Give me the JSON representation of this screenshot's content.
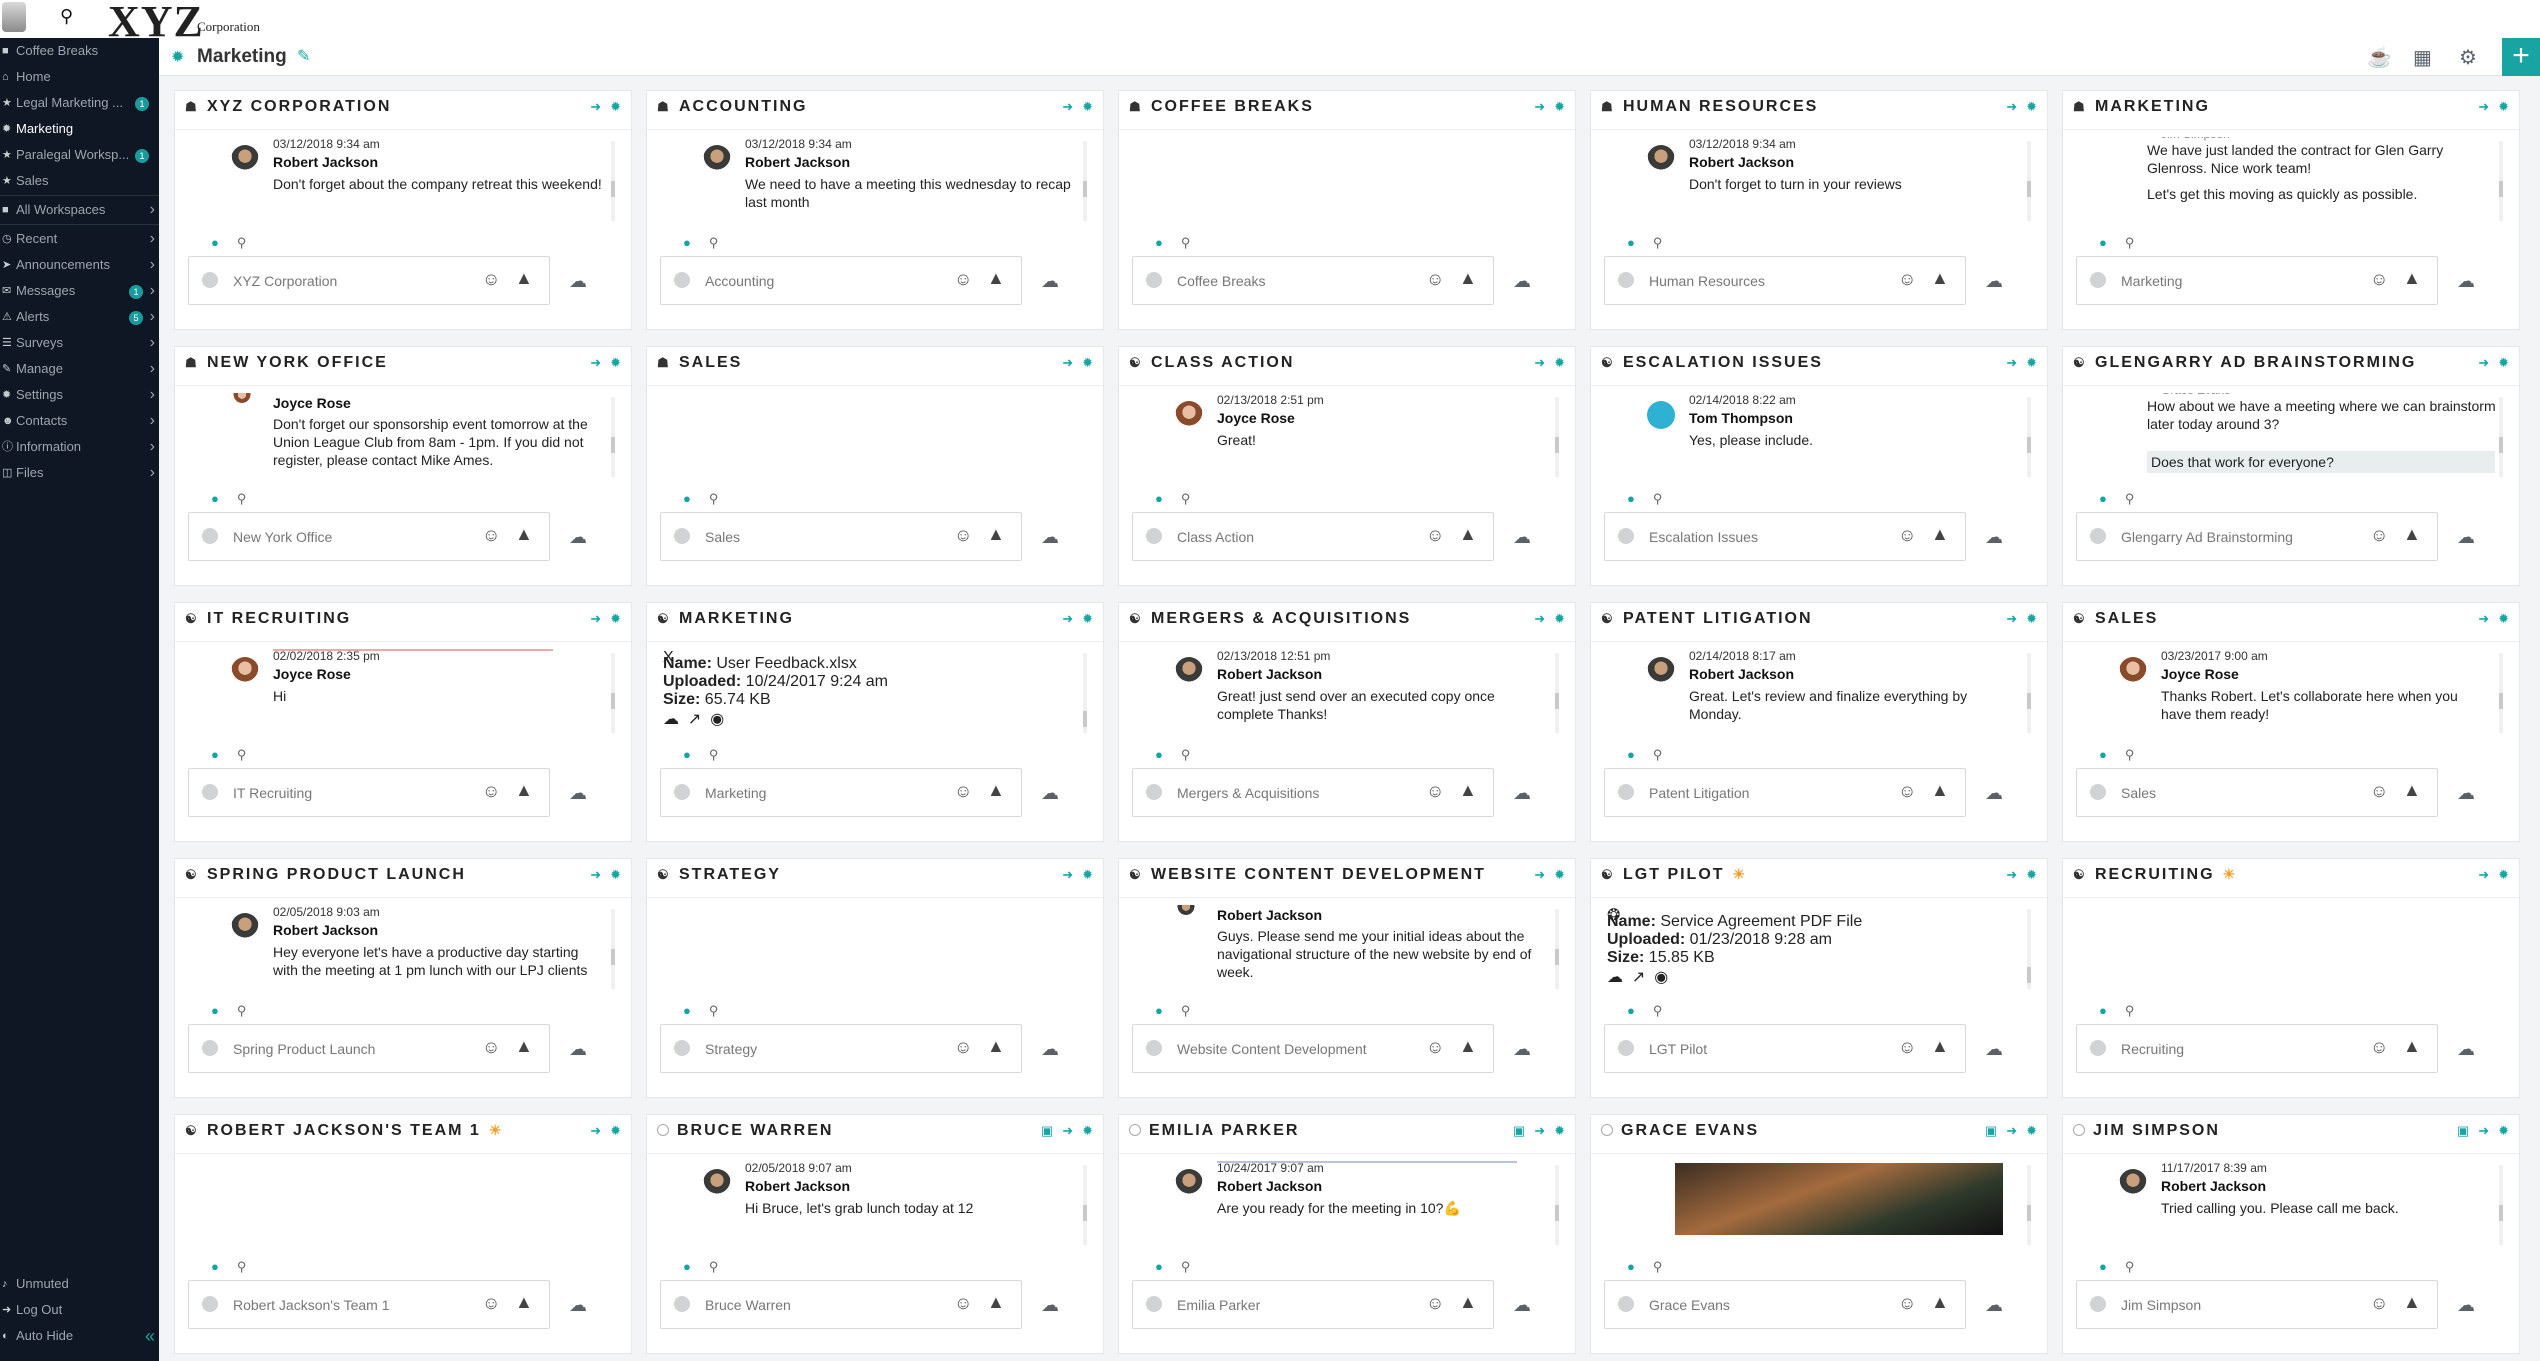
{
  "app": {
    "logo": "XYZ",
    "logo_sub": "Corporation"
  },
  "sidebar": {
    "items": [
      {
        "label": "Coffee Breaks",
        "icon": "workspace-icon"
      },
      {
        "label": "Home",
        "icon": "home-icon"
      },
      {
        "label": "Legal Marketing ...",
        "icon": "star-icon",
        "badge": "1"
      },
      {
        "label": "Marketing",
        "icon": "gear-icon",
        "active": true
      },
      {
        "label": "Paralegal Worksp...",
        "icon": "star-icon",
        "badge": "1"
      },
      {
        "label": "Sales",
        "icon": "star-icon"
      }
    ],
    "sections": [
      {
        "label": "All Workspaces",
        "icon": "workspace-icon"
      },
      {
        "label": "Recent",
        "icon": "clock-icon"
      },
      {
        "label": "Announcements",
        "icon": "megaphone-icon"
      },
      {
        "label": "Messages",
        "icon": "message-icon",
        "badge": "1"
      },
      {
        "label": "Alerts",
        "icon": "alert-icon",
        "badge": "5"
      },
      {
        "label": "Surveys",
        "icon": "survey-icon"
      },
      {
        "label": "Manage",
        "icon": "pencil-icon"
      },
      {
        "label": "Settings",
        "icon": "gear-icon"
      },
      {
        "label": "Contacts",
        "icon": "contacts-icon"
      },
      {
        "label": "Information",
        "icon": "info-icon"
      },
      {
        "label": "Files",
        "icon": "folder-icon"
      }
    ],
    "bottom": {
      "unmuted": "Unmuted",
      "logout": "Log Out",
      "autohide": "Auto Hide"
    }
  },
  "header": {
    "title": "Marketing"
  },
  "cards": [
    {
      "title": "XYZ CORPORATION",
      "icon": "building-icon",
      "date": "03/12/2018 9:34 am",
      "author": "Robert Jackson",
      "text": "Don't forget about the company retreat this weekend!",
      "placeholder": "XYZ Corporation"
    },
    {
      "title": "ACCOUNTING",
      "icon": "building-icon",
      "date": "03/12/2018 9:34 am",
      "author": "Robert Jackson",
      "text": "We need to have a meeting this wednesday to recap last month",
      "placeholder": "Accounting"
    },
    {
      "title": "COFFEE BREAKS",
      "icon": "building-icon",
      "placeholder": "Coffee Breaks"
    },
    {
      "title": "HUMAN RESOURCES",
      "icon": "building-icon",
      "date": "03/12/2018 9:34 am",
      "author": "Robert Jackson",
      "text": "Don't forget to turn in your reviews",
      "placeholder": "Human Resources"
    },
    {
      "title": "MARKETING",
      "icon": "building-icon",
      "author_partial": "Jim Simpson",
      "text": "We have just landed the contract for Glen Garry Glenross. Nice work team!",
      "text2": "Let's get this moving as quickly as possible.",
      "placeholder": "Marketing"
    },
    {
      "title": "NEW YORK OFFICE",
      "icon": "building-icon",
      "author": "Joyce Rose",
      "text": "Don't forget our sponsorship event tomorrow at the Union League Club from 8am - 1pm.  If you did not register, please contact Mike Ames.",
      "placeholder": "New York Office"
    },
    {
      "title": "SALES",
      "icon": "building-icon",
      "placeholder": "Sales"
    },
    {
      "title": "CLASS ACTION",
      "icon": "group-icon",
      "date": "02/13/2018 2:51 pm",
      "author": "Joyce Rose",
      "text": "Great!",
      "placeholder": "Class Action"
    },
    {
      "title": "ESCALATION ISSUES",
      "icon": "group-icon",
      "date": "02/14/2018 8:22 am",
      "author": "Tom Thompson",
      "text": "Yes, please include.",
      "placeholder": "Escalation Issues"
    },
    {
      "title": "GLENGARRY AD BRAINSTORMING",
      "icon": "group-icon",
      "author_partial": "Grace Evans",
      "text": "How about we have a meeting where we can brainstorm later today around 3?",
      "reply": "Does that work for everyone?",
      "placeholder": "Glengarry Ad Brainstorming"
    },
    {
      "title": "IT RECRUITING",
      "icon": "group-icon",
      "date": "02/02/2018 2:35 pm",
      "author": "Joyce Rose",
      "text": "Hi",
      "placeholder": "IT Recruiting"
    },
    {
      "title": "MARKETING",
      "icon": "group-icon",
      "file": {
        "name_label": "Name:",
        "name": "User Feedback.xlsx",
        "uploaded_label": "Uploaded:",
        "uploaded": "10/24/2017 9:24 am",
        "size_label": "Size:",
        "size": "65.74 KB"
      },
      "placeholder": "Marketing"
    },
    {
      "title": "MERGERS & ACQUISITIONS",
      "icon": "group-icon",
      "date": "02/13/2018 12:51 pm",
      "author": "Robert Jackson",
      "text": "Great! just send over an executed copy once complete Thanks!",
      "placeholder": "Mergers & Acquisitions"
    },
    {
      "title": "PATENT LITIGATION",
      "icon": "group-icon",
      "date": "02/14/2018 8:17 am",
      "author": "Robert Jackson",
      "text": "Great.  Let's review and finalize everything by Monday.",
      "placeholder": "Patent Litigation"
    },
    {
      "title": "SALES",
      "icon": "group-icon",
      "date": "03/23/2017 9:00 am",
      "author": "Joyce Rose",
      "text": "Thanks Robert. Let's collaborate here when you have them ready!",
      "placeholder": "Sales"
    },
    {
      "title": "SPRING PRODUCT LAUNCH",
      "icon": "group-icon",
      "date": "02/05/2018 9:03 am",
      "author": "Robert Jackson",
      "text": "Hey everyone let's have a productive day starting with the meeting at 1 pm lunch with our LPJ clients",
      "placeholder": "Spring Product Launch"
    },
    {
      "title": "STRATEGY",
      "icon": "group-icon",
      "placeholder": "Strategy"
    },
    {
      "title": "WEBSITE CONTENT DEVELOPMENT",
      "icon": "group-icon",
      "author": "Robert Jackson",
      "text": "Guys.  Please send me your initial ideas about the navigational structure of the new website by end of week.",
      "placeholder": "Website Content Development"
    },
    {
      "title": "LGT PILOT",
      "icon": "group-icon",
      "sun": true,
      "file": {
        "name_label": "Name:",
        "name": "Service Agreement PDF File",
        "uploaded_label": "Uploaded:",
        "uploaded": "01/23/2018 9:28 am",
        "size_label": "Size:",
        "size": "15.85 KB"
      },
      "placeholder": "LGT Pilot"
    },
    {
      "title": "RECRUITING",
      "icon": "group-icon",
      "sun": true,
      "placeholder": "Recruiting"
    },
    {
      "title": "ROBERT JACKSON'S TEAM 1",
      "icon": "group-icon",
      "sun": true,
      "placeholder": "Robert Jackson's Team 1"
    },
    {
      "title": "BRUCE WARREN",
      "icon": "circle-icon",
      "video": true,
      "date": "02/05/2018 9:07 am",
      "author": "Robert Jackson",
      "text": "Hi Bruce, let's grab lunch today at 12",
      "placeholder": "Bruce Warren"
    },
    {
      "title": "EMILIA PARKER",
      "icon": "circle-icon",
      "video": true,
      "date": "10/24/2017 9:07 am",
      "author": "Robert Jackson",
      "text": "Are you ready for the meeting in 10?💪",
      "placeholder": "Emilia Parker"
    },
    {
      "title": "GRACE EVANS",
      "icon": "circle-icon",
      "video": true,
      "photo": true,
      "placeholder": "Grace Evans"
    },
    {
      "title": "JIM SIMPSON",
      "icon": "circle-icon",
      "video": true,
      "date": "11/17/2017 8:39 am",
      "author": "Robert Jackson",
      "text": "Tried calling you. Please call me back.",
      "placeholder": "Jim Simpson"
    }
  ]
}
